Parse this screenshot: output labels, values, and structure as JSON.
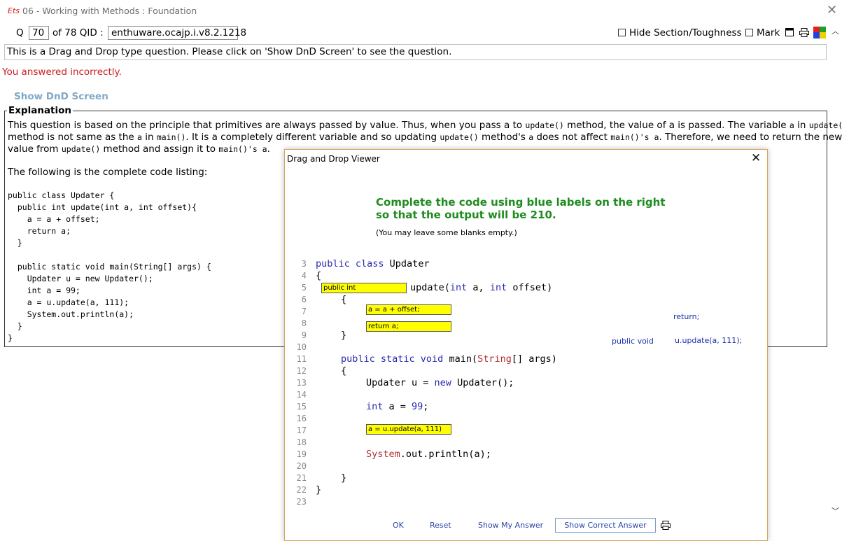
{
  "window": {
    "logo": "Ets",
    "title": "06 - Working with Methods :  Foundation"
  },
  "toolbar": {
    "q_label": "Q",
    "q_number": "70",
    "of_label": "of 78 QID :",
    "qid": "enthuware.ocajp.i.v8.2.1218",
    "hide_label": "Hide Section/Toughness",
    "mark_label": "Mark"
  },
  "question": {
    "prompt": "This is a Drag and Drop type question. Please click on 'Show DnD Screen' to see the question.",
    "result": "You answered incorrectly.",
    "show_dnd": "Show DnD Screen"
  },
  "explanation": {
    "legend": "Explanation",
    "l1a": "This question is based on the principle that primitives are always passed by value. Thus, when you pass a to ",
    "l1b": "update()",
    "l1c": " method, the value of a is passed. The variable ",
    "l1d": "a",
    "l1e": " in ",
    "l1f": "update()",
    "l2a": "method is not same as the ",
    "l2b": "a",
    "l2c": " in ",
    "l2d": "main()",
    "l2e": ". It is a completely different variable and so updating ",
    "l2f": "update()",
    "l2g": " method's ",
    "l2h": "a",
    "l2i": " does not affect ",
    "l2j": "main()'s a",
    "l2k": ". Therefore, we need to return the new",
    "l3a": "value from ",
    "l3b": "update()",
    "l3c": " method and assign it to ",
    "l3d": "main()'s a",
    "l3e": ".",
    "listing_intro": "The following is the complete code listing:",
    "code": [
      "public class Updater {",
      "  public int update(int a, int offset){",
      "    a = a + offset;",
      "    return a;",
      "  }",
      "",
      "  public static void main(String[] args) {",
      "    Updater u = new Updater();",
      "    int a = 99;",
      "    a = u.update(a, 111);",
      "    System.out.println(a);",
      "  }",
      "}"
    ]
  },
  "dialog": {
    "title": "Drag and Drop Viewer",
    "instruction_line1": "Complete the code using blue labels on the right",
    "instruction_line2": "so that the output will be 210.",
    "note": "(You may leave some blanks empty.)",
    "line_numbers": [
      "3",
      "4",
      "5",
      "6",
      "7",
      "8",
      "9",
      "10",
      "11",
      "12",
      "13",
      "14",
      "15",
      "16",
      "17",
      "18",
      "19",
      "20",
      "21",
      "22",
      "23"
    ],
    "code": {
      "l3_kw": "public class",
      "l3_rest": " Updater",
      "l4": "{",
      "l5_a": "update(",
      "l5_kw1": "int",
      "l5_b": " a, ",
      "l5_kw2": "int",
      "l5_c": " offset)",
      "l6": "{",
      "l9": "}",
      "l11_kw": "public static void",
      "l11_a": " main(",
      "l11_str": "String",
      "l11_b": "[] args)",
      "l12": "{",
      "l13_a": "Updater u = ",
      "l13_kw": "new",
      "l13_b": " Updater();",
      "l15_kw": "int",
      "l15_b": " a = ",
      "l15_num": "99",
      "l15_c": ";",
      "l19_str": "System",
      "l19_b": ".out.println(a);",
      "l21": "}",
      "l22": "}"
    },
    "slots": {
      "s1": "public int",
      "s2": "a = a + offset;",
      "s3": "return a;",
      "s4": "a = u.update(a, 111)"
    },
    "available_labels": {
      "return": "return;",
      "public_void": "public void",
      "update_call": "u.update(a, 111);"
    },
    "buttons": {
      "ok": "OK",
      "reset": "Reset",
      "show_my": "Show My Answer",
      "show_correct": "Show Correct Answer"
    }
  },
  "colors": {
    "accent_green": "#1e8c1e",
    "label_blue": "#1c31a9",
    "slot_yellow": "#ffff00",
    "error_red": "#c81e1e"
  }
}
